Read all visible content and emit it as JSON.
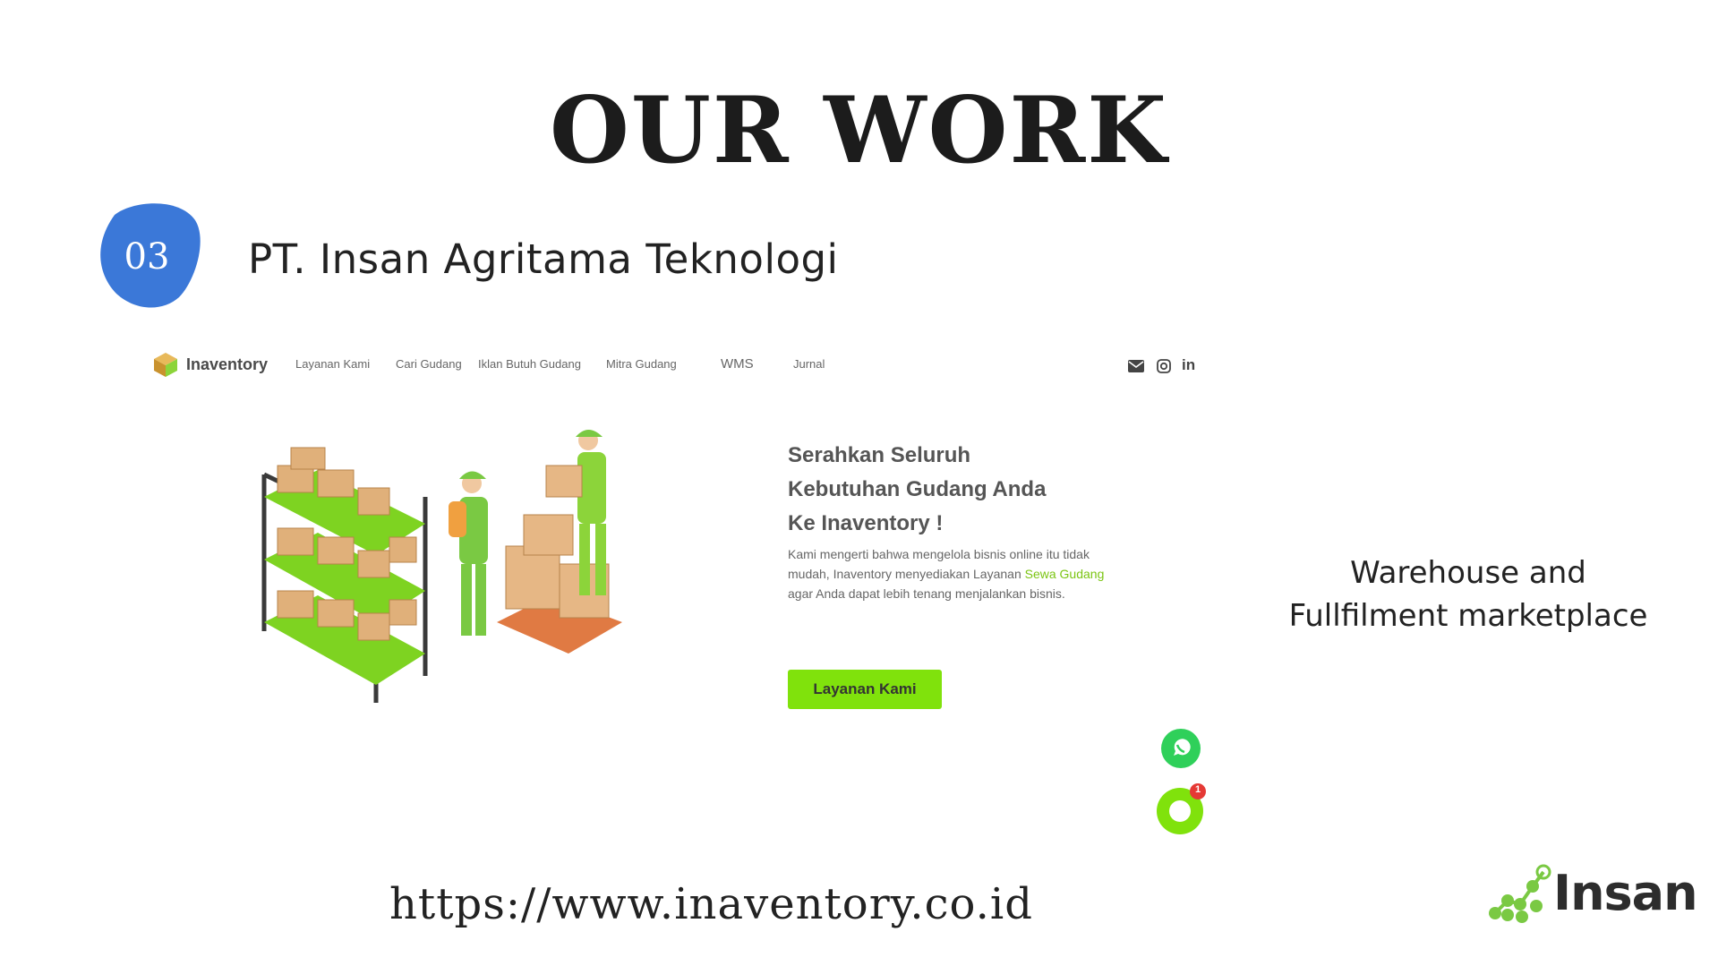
{
  "slide": {
    "title": "OUR WORK",
    "number": "03",
    "company": "PT. Insan Agritama Teknologi",
    "description_line1": "Warehouse and",
    "description_line2": "Fullfilment marketplace",
    "url": "https://www.inaventory.co.id",
    "brand": "Insan"
  },
  "site": {
    "logo_text": "Inaventory",
    "nav": [
      "Layanan Kami",
      "Cari Gudang",
      "Iklan Butuh Gudang",
      "Mitra Gudang",
      "WMS",
      "Jurnal"
    ],
    "social_icons": [
      "mail-icon",
      "instagram-icon",
      "linkedin-icon"
    ],
    "linkedin_label": "in",
    "hero_title_line1": "Serahkan Seluruh",
    "hero_title_line2": "Kebutuhan Gudang Anda",
    "hero_title_line3": "Ke Inaventory !",
    "hero_desc_before": "Kami mengerti bahwa mengelola bisnis online itu tidak mudah, Inaventory menyediakan Layanan ",
    "hero_desc_highlight": "Sewa Gudang",
    "hero_desc_after": " agar Anda dapat lebih tenang menjalankan bisnis.",
    "cta_label": "Layanan Kami",
    "chat_badge": "1"
  },
  "colors": {
    "badge_blue": "#3b78d8",
    "accent_green": "#80e20c",
    "text_dark": "#222222"
  }
}
